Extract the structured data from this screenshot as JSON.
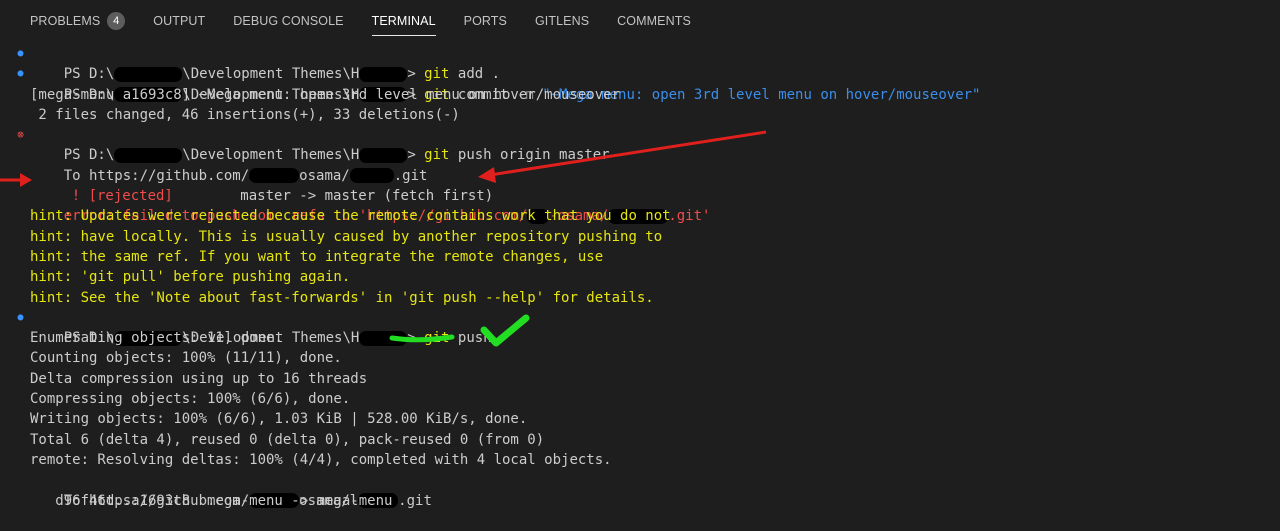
{
  "tabs": [
    {
      "label": "PROBLEMS",
      "badge": "4",
      "active": false
    },
    {
      "label": "OUTPUT",
      "active": false
    },
    {
      "label": "DEBUG CONSOLE",
      "active": false
    },
    {
      "label": "TERMINAL",
      "active": true
    },
    {
      "label": "PORTS",
      "active": false
    },
    {
      "label": "GITLENS",
      "active": false
    },
    {
      "label": "COMMENTS",
      "active": false
    }
  ],
  "terminal": {
    "prompt_prefix": "PS D:\\",
    "prompt_mid": "\\Development Themes\\H",
    "prompt_end": "> ",
    "cmd1": {
      "git": "git",
      "rest": " add ."
    },
    "cmd2": {
      "git": "git",
      "rest": " commit ",
      "flag": "-m",
      "str": " \"~Mega menu: open 3rd level menu on hover/mouseover\""
    },
    "out_commit_1": "[mega-menu a1693c8] ~Mega menu: open 3rd level menu on hover/mouseover",
    "out_commit_2": " 2 files changed, 46 insertions(+), 33 deletions(-)",
    "cmd3": {
      "git": "git",
      "rest": " push origin master"
    },
    "to_prefix": "To https://github.com/",
    "to_mid": "osama/",
    "to_end": ".git",
    "rejected_tag": "! [rejected]",
    "rejected_rest": "        master -> master (fetch first)",
    "error_prefix": "error: failed to push some refs to 'https://github.com/",
    "error_mid": "-osama/",
    "error_end": ".git'",
    "hints": [
      "hint: Updates were rejected because the remote contains work that you do not",
      "hint: have locally. This is usually caused by another repository pushing to",
      "hint: the same ref. If you want to integrate the remote changes, use",
      "hint: 'git pull' before pushing again.",
      "hint: See the 'Note about fast-forwards' in 'git push --help' for details."
    ],
    "cmd4": {
      "git": "git",
      "rest": " push"
    },
    "push_output": [
      "Enumerating objects: 11, done.",
      "Counting objects: 100% (11/11), done.",
      "Delta compression using up to 16 threads",
      "Compressing objects: 100% (6/6), done.",
      "Writing objects: 100% (6/6), 1.03 KiB | 528.00 KiB/s, done.",
      "Total 6 (delta 4), reused 0 (delta 0), pack-reused 0 (from 0)",
      "remote: Resolving deltas: 100% (4/4), completed with 4 local objects."
    ],
    "final_to_prefix": "To https://github.com/",
    "final_to_mid": "osama/l",
    "final_to_end": ".git",
    "final_range": "   d96f46d..a1693c8  mega-menu -> mega-menu"
  },
  "colors": {
    "background": "#1e1e1e",
    "error": "#f14c4c",
    "hint": "#e5e510",
    "string": "#3b8eea",
    "success_check": "#22dd22",
    "annotation_arrow": "#e0201c"
  }
}
